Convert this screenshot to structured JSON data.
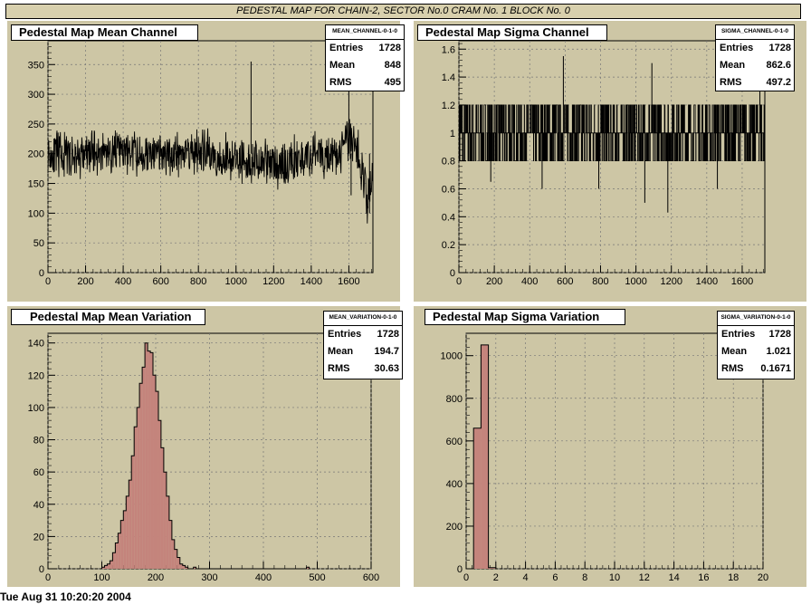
{
  "banner": "PEDESTAL MAP FOR CHAIN-2, SECTOR No.0 CRAM No. 1 BLOCK No. 0",
  "footer": "Tue Aug 31 10:20:20 2004",
  "colors": {
    "pad": "#cdc6a5",
    "hist_fill": "#c4847c",
    "line": "#000000"
  },
  "chart_data": [
    {
      "type": "line",
      "title": "Pedestal Map Mean Channel",
      "stats": {
        "name": "MEAN_CHANNEL-0-1-0",
        "entries_label": "Entries",
        "entries": "1728",
        "mean_label": "Mean",
        "mean": "848",
        "rms_label": "RMS",
        "rms": "495"
      },
      "xlim": [
        0,
        1728
      ],
      "ylim": [
        0,
        390
      ],
      "x_ticks": [
        0,
        200,
        400,
        600,
        800,
        1000,
        1200,
        1400,
        1600
      ],
      "y_ticks": [
        0,
        50,
        100,
        150,
        200,
        250,
        300,
        350
      ],
      "noise": {
        "base": 195,
        "amp": 45,
        "seed": 11
      },
      "segments": [
        [
          0,
          200
        ],
        [
          150,
          195
        ],
        [
          300,
          205
        ],
        [
          450,
          200
        ],
        [
          600,
          195
        ],
        [
          750,
          205
        ],
        [
          900,
          195
        ],
        [
          1050,
          190
        ],
        [
          1150,
          185
        ],
        [
          1250,
          180
        ],
        [
          1400,
          200
        ],
        [
          1550,
          195
        ],
        [
          1600,
          230
        ],
        [
          1650,
          200
        ],
        [
          1700,
          120
        ],
        [
          1728,
          160
        ]
      ],
      "spikes": [
        [
          1080,
          355
        ],
        [
          1600,
          335
        ],
        [
          1612,
          130
        ],
        [
          1710,
          100
        ]
      ],
      "grid": true
    },
    {
      "type": "line",
      "title": "Pedestal Map Sigma Channel",
      "stats": {
        "name": "SIGMA_CHANNEL-0-1-0",
        "entries_label": "Entries",
        "entries": "1728",
        "mean_label": "Mean",
        "mean": "862.6",
        "rms_label": "RMS",
        "rms": "497.2"
      },
      "xlim": [
        0,
        1728
      ],
      "ylim": [
        0,
        1.66
      ],
      "x_ticks": [
        0,
        200,
        400,
        600,
        800,
        1000,
        1200,
        1400,
        1600
      ],
      "y_ticks": [
        0,
        0.2,
        0.4,
        0.6,
        0.8,
        1,
        1.2,
        1.4,
        1.6
      ],
      "y_tick_labels": [
        "0",
        "0.2",
        "0.4",
        "0.6",
        "0.8",
        "1",
        "1.2",
        "1.4",
        "1.6"
      ],
      "levels": [
        0.8,
        1.0,
        1.2
      ],
      "spikes": [
        [
          180,
          0.65
        ],
        [
          470,
          0.6
        ],
        [
          790,
          0.6
        ],
        [
          1050,
          0.5
        ],
        [
          1180,
          0.43
        ],
        [
          1460,
          0.6
        ],
        [
          590,
          1.55
        ],
        [
          1090,
          1.5
        ],
        [
          1700,
          1.5
        ]
      ],
      "grid": true
    },
    {
      "type": "bar",
      "title": "Pedestal Map Mean Variation",
      "stats": {
        "name": "MEAN_VARIATION-0-1-0",
        "entries_label": "Entries",
        "entries": "1728",
        "mean_label": "Mean",
        "mean": "194.7",
        "rms_label": "RMS",
        "rms": "30.63"
      },
      "xlim": [
        0,
        600
      ],
      "ylim": [
        0,
        146
      ],
      "x_ticks": [
        0,
        100,
        200,
        300,
        400,
        500,
        600
      ],
      "y_ticks": [
        0,
        20,
        40,
        60,
        80,
        100,
        120,
        140
      ],
      "bin_start": 100,
      "bin_width": 5,
      "values": [
        1,
        2,
        3,
        5,
        10,
        16,
        22,
        30,
        36,
        45,
        55,
        70,
        88,
        100,
        115,
        125,
        140,
        135,
        134,
        120,
        110,
        92,
        75,
        60,
        45,
        30,
        18,
        12,
        7,
        3,
        2,
        1,
        0,
        0,
        1,
        0,
        0,
        0,
        0,
        0,
        0,
        0,
        0,
        0,
        0,
        0,
        0,
        0,
        0,
        0,
        0,
        0,
        0,
        0,
        0,
        0,
        0,
        0,
        0,
        0,
        0,
        0,
        0,
        0,
        0,
        0,
        0,
        0,
        0,
        0,
        0,
        0,
        0,
        0,
        0,
        0,
        1
      ],
      "grid": true
    },
    {
      "type": "bar",
      "title": "Pedestal Map Sigma Variation",
      "stats": {
        "name": "SIGMA_VARIATION-0-1-0",
        "entries_label": "Entries",
        "entries": "1728",
        "mean_label": "Mean",
        "mean": "1.021",
        "rms_label": "RMS",
        "rms": "0.1671"
      },
      "xlim": [
        0,
        20
      ],
      "ylim": [
        0,
        1105
      ],
      "x_ticks": [
        0,
        2,
        4,
        6,
        8,
        10,
        12,
        14,
        16,
        18,
        20
      ],
      "y_ticks": [
        0,
        200,
        400,
        600,
        800,
        1000
      ],
      "bin_start": 0,
      "bin_width": 0.5,
      "values": [
        0,
        660,
        1050,
        5
      ],
      "grid": true
    }
  ]
}
